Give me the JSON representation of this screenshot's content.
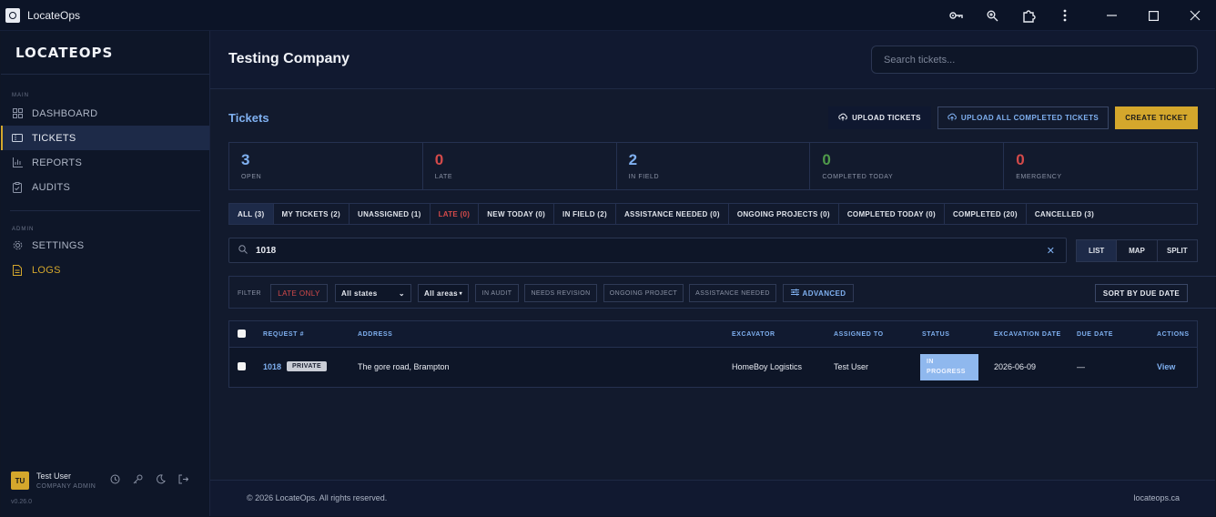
{
  "window": {
    "title": "LocateOps",
    "icons": [
      "key-icon",
      "zoom-icon",
      "extension-icon",
      "more-icon",
      "minimize-icon",
      "maximize-icon",
      "close-icon"
    ]
  },
  "sidebar": {
    "logo": "LOCATEOPS",
    "section_main": "MAIN",
    "items_main": [
      {
        "label": "DASHBOARD",
        "icon": "dashboard-icon"
      },
      {
        "label": "TICKETS",
        "icon": "ticket-icon",
        "active": true
      },
      {
        "label": "REPORTS",
        "icon": "chart-icon"
      },
      {
        "label": "AUDITS",
        "icon": "clipboard-icon"
      }
    ],
    "section_admin": "ADMIN",
    "items_admin": [
      {
        "label": "SETTINGS",
        "icon": "gear-icon"
      },
      {
        "label": "LOGS",
        "icon": "document-icon"
      }
    ],
    "user": {
      "initials": "TU",
      "name": "Test User",
      "role": "COMPANY ADMIN"
    },
    "version": "v0.26.0"
  },
  "header": {
    "company": "Testing Company",
    "search_placeholder": "Search tickets..."
  },
  "page": {
    "title": "Tickets",
    "buttons": {
      "upload": "UPLOAD TICKETS",
      "upload_all": "UPLOAD ALL COMPLETED TICKETS",
      "create": "CREATE TICKET"
    },
    "stats": [
      {
        "value": "3",
        "label": "OPEN"
      },
      {
        "value": "0",
        "label": "LATE"
      },
      {
        "value": "2",
        "label": "IN FIELD"
      },
      {
        "value": "0",
        "label": "COMPLETED TODAY"
      },
      {
        "value": "0",
        "label": "EMERGENCY"
      }
    ],
    "tabs": [
      "ALL (3)",
      "MY TICKETS (2)",
      "UNASSIGNED (1)",
      "LATE (0)",
      "NEW TODAY (0)",
      "IN FIELD (2)",
      "ASSISTANCE NEEDED (0)",
      "ONGOING PROJECTS (0)",
      "COMPLETED TODAY (0)",
      "COMPLETED (20)",
      "CANCELLED (3)"
    ],
    "search_value": "1018",
    "views": [
      "LIST",
      "MAP",
      "SPLIT"
    ],
    "filter": {
      "label": "FILTER",
      "late_only": "LATE ONLY",
      "states": "All states",
      "areas": "All areas",
      "chips": [
        "IN AUDIT",
        "NEEDS REVISION",
        "ONGOING PROJECT",
        "ASSISTANCE NEEDED"
      ],
      "advanced": "ADVANCED",
      "sort": "SORT BY DUE DATE"
    },
    "table": {
      "columns": [
        "REQUEST #",
        "ADDRESS",
        "EXCAVATOR",
        "ASSIGNED TO",
        "STATUS",
        "EXCAVATION DATE",
        "DUE DATE",
        "ACTIONS"
      ],
      "rows": [
        {
          "request": "1018",
          "badge": "PRIVATE",
          "address": "The gore road, Brampton",
          "excavator": "HomeBoy Logistics",
          "assigned": "Test User",
          "status": "IN PROGRESS",
          "excavation_date": "2026-06-09",
          "due_date": "—",
          "action": "View"
        }
      ]
    }
  },
  "footer": {
    "copyright": "© 2026 LocateOps. All rights reserved.",
    "site": "locateops.ca"
  }
}
